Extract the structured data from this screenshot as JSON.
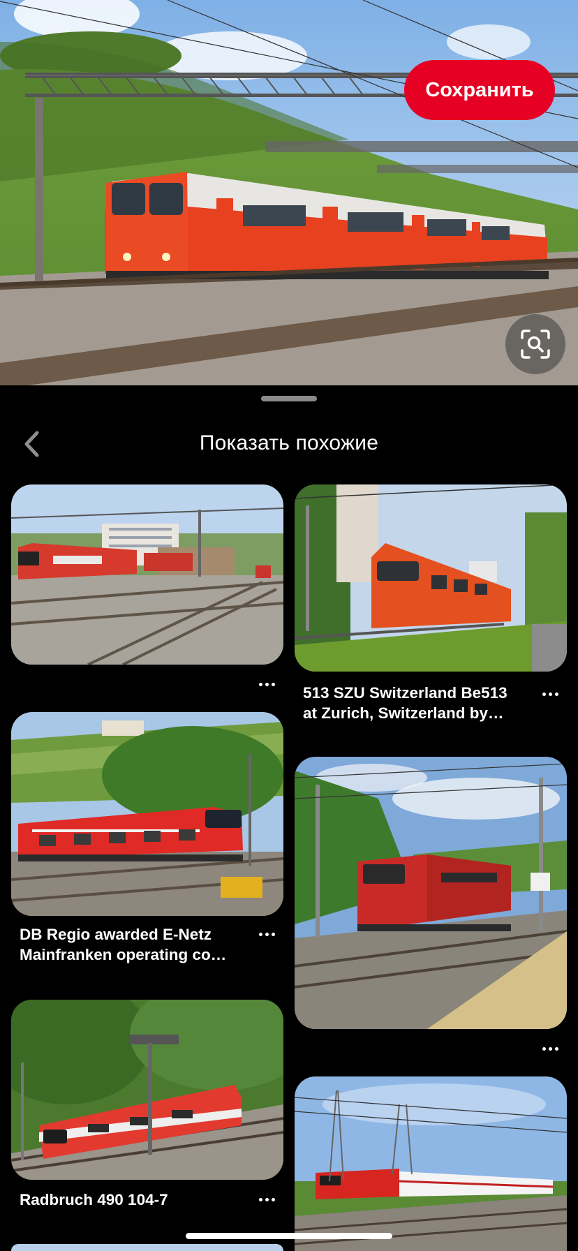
{
  "hero": {
    "save_label": "Сохранить",
    "icons": {
      "lens": "visual-search-icon"
    },
    "colors": {
      "save": "#e60023"
    }
  },
  "sheet": {
    "title": "Показать похожие",
    "icons": {
      "back": "chevron-left-icon",
      "more": "more-dots-icon"
    }
  },
  "pins": [
    {
      "caption": ""
    },
    {
      "caption_line1": "513 SZU Switzerland Be513",
      "caption_line2": "at Zurich, Switzerland by…"
    },
    {
      "caption_line1": "DB Regio awarded E-Netz",
      "caption_line2": "Mainfranken operating co…"
    },
    {
      "caption": ""
    },
    {
      "caption": "Radbruch 490 104-7"
    },
    {
      "caption": ""
    }
  ]
}
